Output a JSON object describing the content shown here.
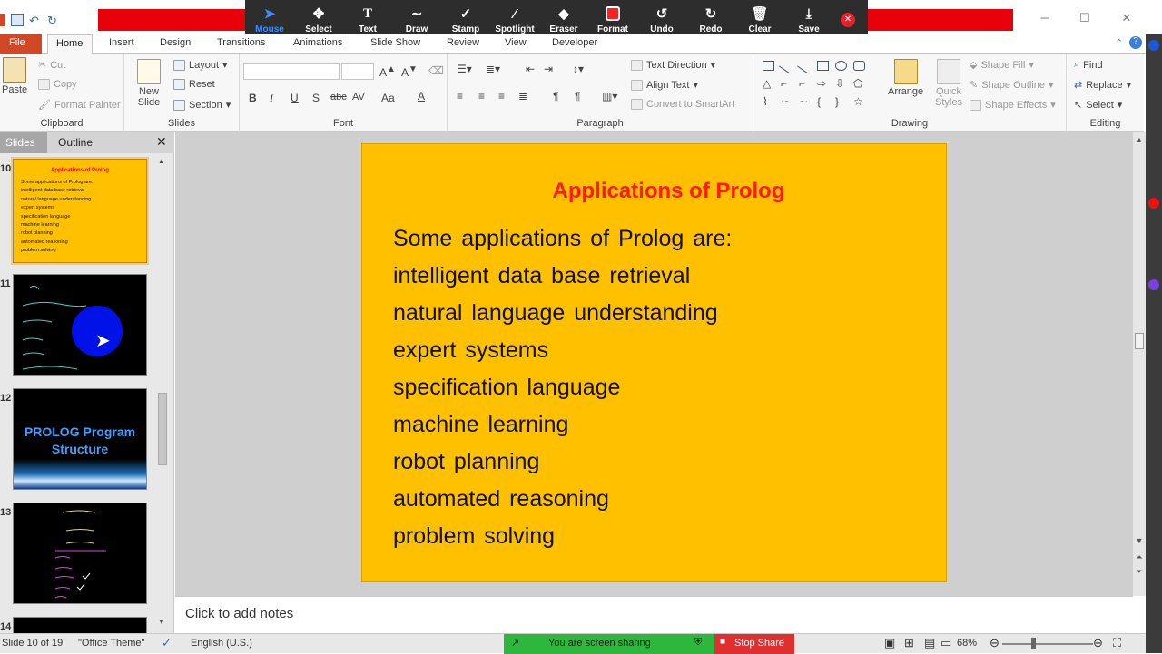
{
  "zoom_toolbar": {
    "tools": [
      {
        "label": "Mouse",
        "icon": "cursor-icon"
      },
      {
        "label": "Select",
        "icon": "move-icon"
      },
      {
        "label": "Text",
        "icon": "text-icon"
      },
      {
        "label": "Draw",
        "icon": "squiggle-icon"
      },
      {
        "label": "Stamp",
        "icon": "check-icon"
      },
      {
        "label": "Spotlight",
        "icon": "wand-icon"
      },
      {
        "label": "Eraser",
        "icon": "eraser-icon"
      },
      {
        "label": "Format",
        "icon": "format-color-icon"
      },
      {
        "label": "Undo",
        "icon": "undo-icon"
      },
      {
        "label": "Redo",
        "icon": "redo-icon"
      },
      {
        "label": "Clear",
        "icon": "trash-icon"
      },
      {
        "label": "Save",
        "icon": "download-icon"
      }
    ],
    "active": "Mouse"
  },
  "tabs": [
    "File",
    "Home",
    "Insert",
    "Design",
    "Transitions",
    "Animations",
    "Slide Show",
    "Review",
    "View",
    "Developer"
  ],
  "ribbon": {
    "clipboard": {
      "label": "Clipboard",
      "paste": "Paste",
      "cut": "Cut",
      "copy": "Copy",
      "format_painter": "Format Painter"
    },
    "slides": {
      "label": "Slides",
      "new_slide": "New Slide",
      "layout": "Layout",
      "reset": "Reset",
      "section": "Section"
    },
    "font": {
      "label": "Font",
      "bold": "B",
      "italic": "I",
      "underline": "U",
      "shadow": "S",
      "strike": "abc"
    },
    "paragraph": {
      "label": "Paragraph",
      "text_direction": "Text Direction",
      "align_text": "Align Text",
      "convert_smartart": "Convert to SmartArt"
    },
    "drawing": {
      "label": "Drawing",
      "arrange": "Arrange",
      "quick_styles": "Quick Styles",
      "shape_fill": "Shape Fill",
      "shape_outline": "Shape Outline",
      "shape_effects": "Shape Effects"
    },
    "editing": {
      "label": "Editing",
      "find": "Find",
      "replace": "Replace",
      "select": "Select"
    }
  },
  "panel": {
    "tab_slides": "Slides",
    "tab_outline": "Outline"
  },
  "thumbnails": [
    {
      "num": "10",
      "title": "Applications of Prolog",
      "lines": [
        "Some applications of Prolog are:",
        "intelligent data base retrieval",
        "natural language understanding",
        "expert systems",
        "specification language",
        "machine learning",
        "robot planning",
        "automated reasoning",
        "problem solving"
      ]
    },
    {
      "num": "11"
    },
    {
      "num": "12",
      "title": "PROLOG Program Structure"
    },
    {
      "num": "13"
    },
    {
      "num": "14"
    }
  ],
  "slide": {
    "title": "Applications of Prolog",
    "lines": [
      "Some applications of Prolog are:",
      "intelligent data base retrieval",
      "natural language understanding",
      "expert systems",
      "specification language",
      "machine learning",
      "robot planning",
      "automated reasoning",
      "problem solving"
    ]
  },
  "notes_placeholder": "Click to add notes",
  "status": {
    "slide_info": "Slide 10 of 19",
    "theme": "\"Office Theme\"",
    "language": "English (U.S.)",
    "sharing": "You are screen sharing",
    "stop_share": "Stop Share",
    "zoom": "68%"
  }
}
